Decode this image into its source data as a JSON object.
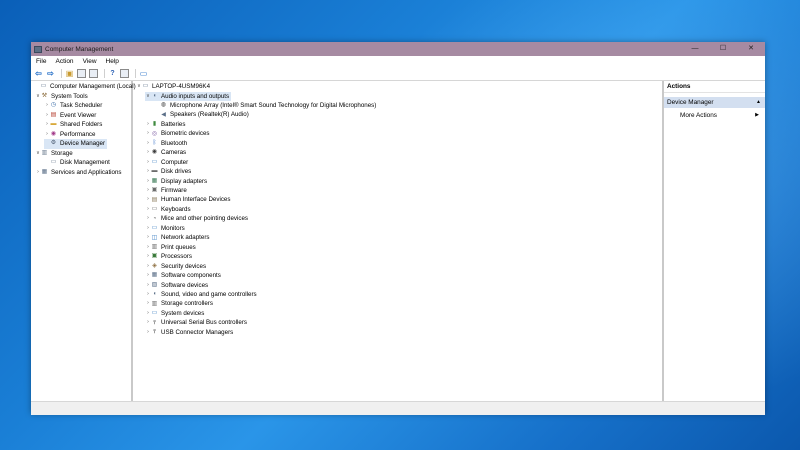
{
  "window": {
    "title": "Computer Management",
    "controls": {
      "minimize": "—",
      "maximize": "☐",
      "close": "✕"
    }
  },
  "menu": [
    "File",
    "Action",
    "View",
    "Help"
  ],
  "left_tree": [
    {
      "label": "Computer Management (Local)",
      "level": 0,
      "expander": "",
      "icon": "computer-icon"
    },
    {
      "label": "System Tools",
      "level": 1,
      "expander": "∨",
      "icon": "tools-icon"
    },
    {
      "label": "Task Scheduler",
      "level": 2,
      "expander": "›",
      "icon": "clock-icon"
    },
    {
      "label": "Event Viewer",
      "level": 2,
      "expander": "›",
      "icon": "event-viewer-icon"
    },
    {
      "label": "Shared Folders",
      "level": 2,
      "expander": "›",
      "icon": "shared-folder-icon"
    },
    {
      "label": "Performance",
      "level": 2,
      "expander": "›",
      "icon": "performance-icon"
    },
    {
      "label": "Device Manager",
      "level": 2,
      "expander": "",
      "icon": "device-manager-icon",
      "selected": true
    },
    {
      "label": "Storage",
      "level": 1,
      "expander": "∨",
      "icon": "storage-icon"
    },
    {
      "label": "Disk Management",
      "level": 2,
      "expander": "",
      "icon": "disk-icon"
    },
    {
      "label": "Services and Applications",
      "level": 1,
      "expander": "›",
      "icon": "services-icon"
    }
  ],
  "device_tree": {
    "root": "LAPTOP-4USM96K4",
    "items": [
      {
        "label": "Audio inputs and outputs",
        "level": 1,
        "expander": "∨",
        "icon": "audio-icon",
        "selected": true
      },
      {
        "label": "Microphone Array (Intel® Smart Sound Technology for Digital Microphones)",
        "level": 2,
        "expander": "",
        "icon": "microphone-icon"
      },
      {
        "label": "Speakers (Realtek(R) Audio)",
        "level": 2,
        "expander": "",
        "icon": "speaker-icon"
      },
      {
        "label": "Batteries",
        "level": 1,
        "expander": "›",
        "icon": "battery-icon"
      },
      {
        "label": "Biometric devices",
        "level": 1,
        "expander": "›",
        "icon": "biometric-icon"
      },
      {
        "label": "Bluetooth",
        "level": 1,
        "expander": "›",
        "icon": "bluetooth-icon"
      },
      {
        "label": "Cameras",
        "level": 1,
        "expander": "›",
        "icon": "camera-icon"
      },
      {
        "label": "Computer",
        "level": 1,
        "expander": "›",
        "icon": "computer-icon"
      },
      {
        "label": "Disk drives",
        "level": 1,
        "expander": "›",
        "icon": "disk-drive-icon"
      },
      {
        "label": "Display adapters",
        "level": 1,
        "expander": "›",
        "icon": "display-adapter-icon"
      },
      {
        "label": "Firmware",
        "level": 1,
        "expander": "›",
        "icon": "firmware-icon"
      },
      {
        "label": "Human Interface Devices",
        "level": 1,
        "expander": "›",
        "icon": "hid-icon"
      },
      {
        "label": "Keyboards",
        "level": 1,
        "expander": "›",
        "icon": "keyboard-icon"
      },
      {
        "label": "Mice and other pointing devices",
        "level": 1,
        "expander": "›",
        "icon": "mouse-icon"
      },
      {
        "label": "Monitors",
        "level": 1,
        "expander": "›",
        "icon": "monitor-icon"
      },
      {
        "label": "Network adapters",
        "level": 1,
        "expander": "›",
        "icon": "network-adapter-icon"
      },
      {
        "label": "Print queues",
        "level": 1,
        "expander": "›",
        "icon": "printer-icon"
      },
      {
        "label": "Processors",
        "level": 1,
        "expander": "›",
        "icon": "processor-icon"
      },
      {
        "label": "Security devices",
        "level": 1,
        "expander": "›",
        "icon": "security-icon"
      },
      {
        "label": "Software components",
        "level": 1,
        "expander": "›",
        "icon": "software-component-icon"
      },
      {
        "label": "Software devices",
        "level": 1,
        "expander": "›",
        "icon": "software-device-icon"
      },
      {
        "label": "Sound, video and game controllers",
        "level": 1,
        "expander": "›",
        "icon": "sound-controller-icon"
      },
      {
        "label": "Storage controllers",
        "level": 1,
        "expander": "›",
        "icon": "storage-controller-icon"
      },
      {
        "label": "System devices",
        "level": 1,
        "expander": "›",
        "icon": "system-device-icon"
      },
      {
        "label": "Universal Serial Bus controllers",
        "level": 1,
        "expander": "›",
        "icon": "usb-icon"
      },
      {
        "label": "USB Connector Managers",
        "level": 1,
        "expander": "›",
        "icon": "usb-connector-icon"
      }
    ]
  },
  "actions": {
    "header": "Actions",
    "section": "Device Manager",
    "section_arrow": "▲",
    "items": [
      {
        "label": "More Actions",
        "arrow": "▶"
      }
    ]
  },
  "colors": {
    "titlebar": "#a68aa2",
    "selection": "#d9e6f5",
    "actions_section": "#d3dff0"
  }
}
